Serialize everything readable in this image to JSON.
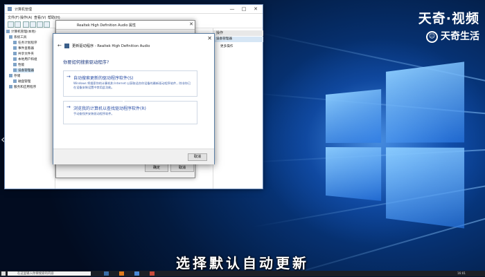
{
  "watermark": {
    "line1": "天奇·视频",
    "line2": "天奇生活",
    "icon": "tianqi-logo-icon"
  },
  "computer_management": {
    "title": "计算机管理",
    "menu": [
      "文件(F)",
      "操作(A)",
      "查看(V)",
      "帮助(H)"
    ],
    "tree": [
      "计算机管理(本地)",
      "系统工具",
      "任务计划程序",
      "事件查看器",
      "共享文件夹",
      "本地用户和组",
      "性能",
      "设备管理器",
      "存储",
      "磁盘管理",
      "服务和应用程序"
    ],
    "actions_header": "操作",
    "actions_sub": "设备管理器",
    "actions_more": "更多操作",
    "controls": {
      "minimize": "—",
      "maximize": "□",
      "close": "✕"
    }
  },
  "properties_dialog": {
    "title": "Realtek High Definition Audio 属性",
    "close": "✕",
    "ok": "确定",
    "cancel": "取消"
  },
  "update_dialog": {
    "back": "←",
    "close": "✕",
    "title": "更新驱动程序 - Realtek High Definition Audio",
    "question": "你要如何搜索驱动程序?",
    "option_auto": {
      "arrow": "→",
      "title": "自动搜索更新的驱动程序软件(S)",
      "desc": "Windows 将搜索你的计算机和 Internet 以获取适合你设备的最新驱动程序软件，除非你已在设备安装设置中禁用此功能。"
    },
    "option_browse": {
      "arrow": "→",
      "title": "浏览我的计算机以查找驱动程序软件(R)",
      "desc": "手动查找并安装驱动程序软件。"
    },
    "cancel": "取消"
  },
  "subtitle": "选择默认自动更新",
  "taskbar": {
    "search_placeholder": "在这里输入你要搜索的内容",
    "clock": "16:01"
  },
  "colors": {
    "link_blue": "#2b4fa6",
    "desktop_blue": "#0a4fb8",
    "selection": "#cce4f7"
  }
}
